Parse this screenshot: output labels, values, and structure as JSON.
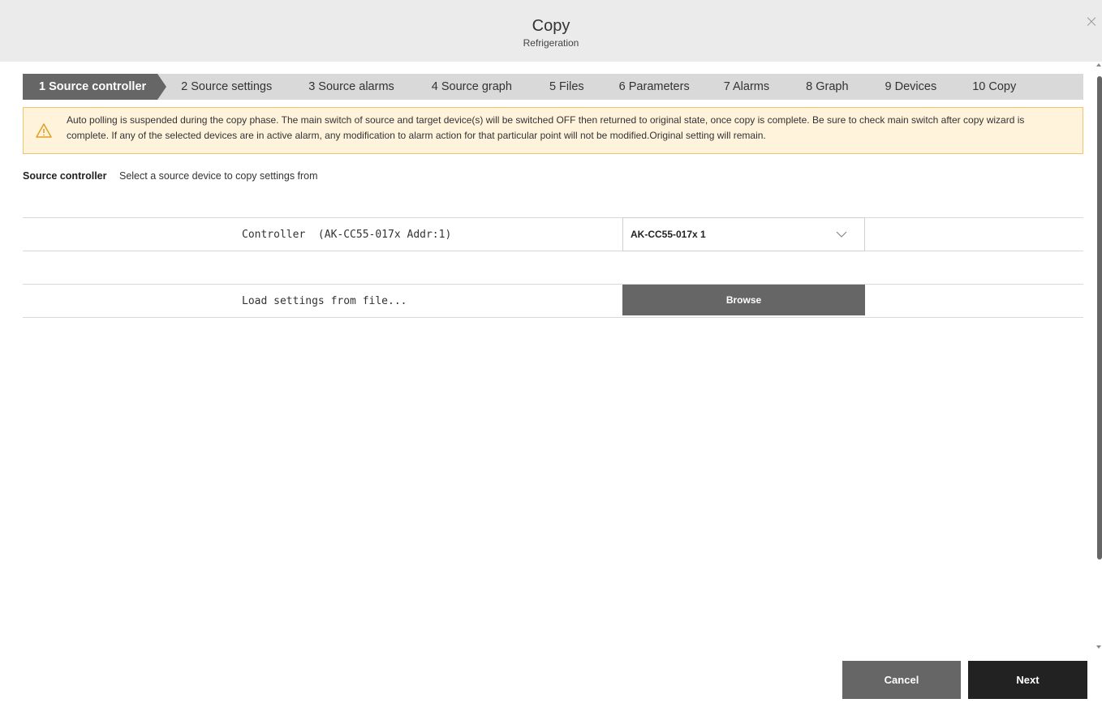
{
  "header": {
    "title": "Copy",
    "subtitle": "Refrigeration",
    "close_label": "×"
  },
  "steps": [
    {
      "label": "1 Source controller",
      "active": true
    },
    {
      "label": "2 Source settings",
      "active": false
    },
    {
      "label": "3 Source alarms",
      "active": false
    },
    {
      "label": "4 Source graph",
      "active": false
    },
    {
      "label": "5 Files",
      "active": false
    },
    {
      "label": "6 Parameters",
      "active": false
    },
    {
      "label": "7 Alarms",
      "active": false
    },
    {
      "label": "8 Graph",
      "active": false
    },
    {
      "label": "9 Devices",
      "active": false
    },
    {
      "label": "10 Copy",
      "active": false
    }
  ],
  "warning": {
    "icon": "warning-triangle-icon",
    "text": "Auto polling is suspended during the copy phase. The main switch of source and target device(s) will be switched OFF then returned to original state, once copy is complete. Be sure to check main switch after copy wizard is complete. If any of the selected devices are in active alarm, any modification to alarm action for that particular point will not be modified.Original setting will remain."
  },
  "section": {
    "title": "Source controller",
    "description": "Select a source device to copy settings from"
  },
  "controller_row": {
    "label": "Controller  (AK-CC55-017x Addr:1)",
    "selected_value": "AK-CC55-017x 1"
  },
  "file_row": {
    "label": "Load settings from file...",
    "button_label": "Browse"
  },
  "footer": {
    "cancel_label": "Cancel",
    "next_label": "Next"
  },
  "colors": {
    "header_bg": "#ebebeb",
    "active_step": "#666666",
    "warning_bg": "#fff3dc",
    "warning_border": "#f0c36d",
    "next_button": "#222222"
  }
}
